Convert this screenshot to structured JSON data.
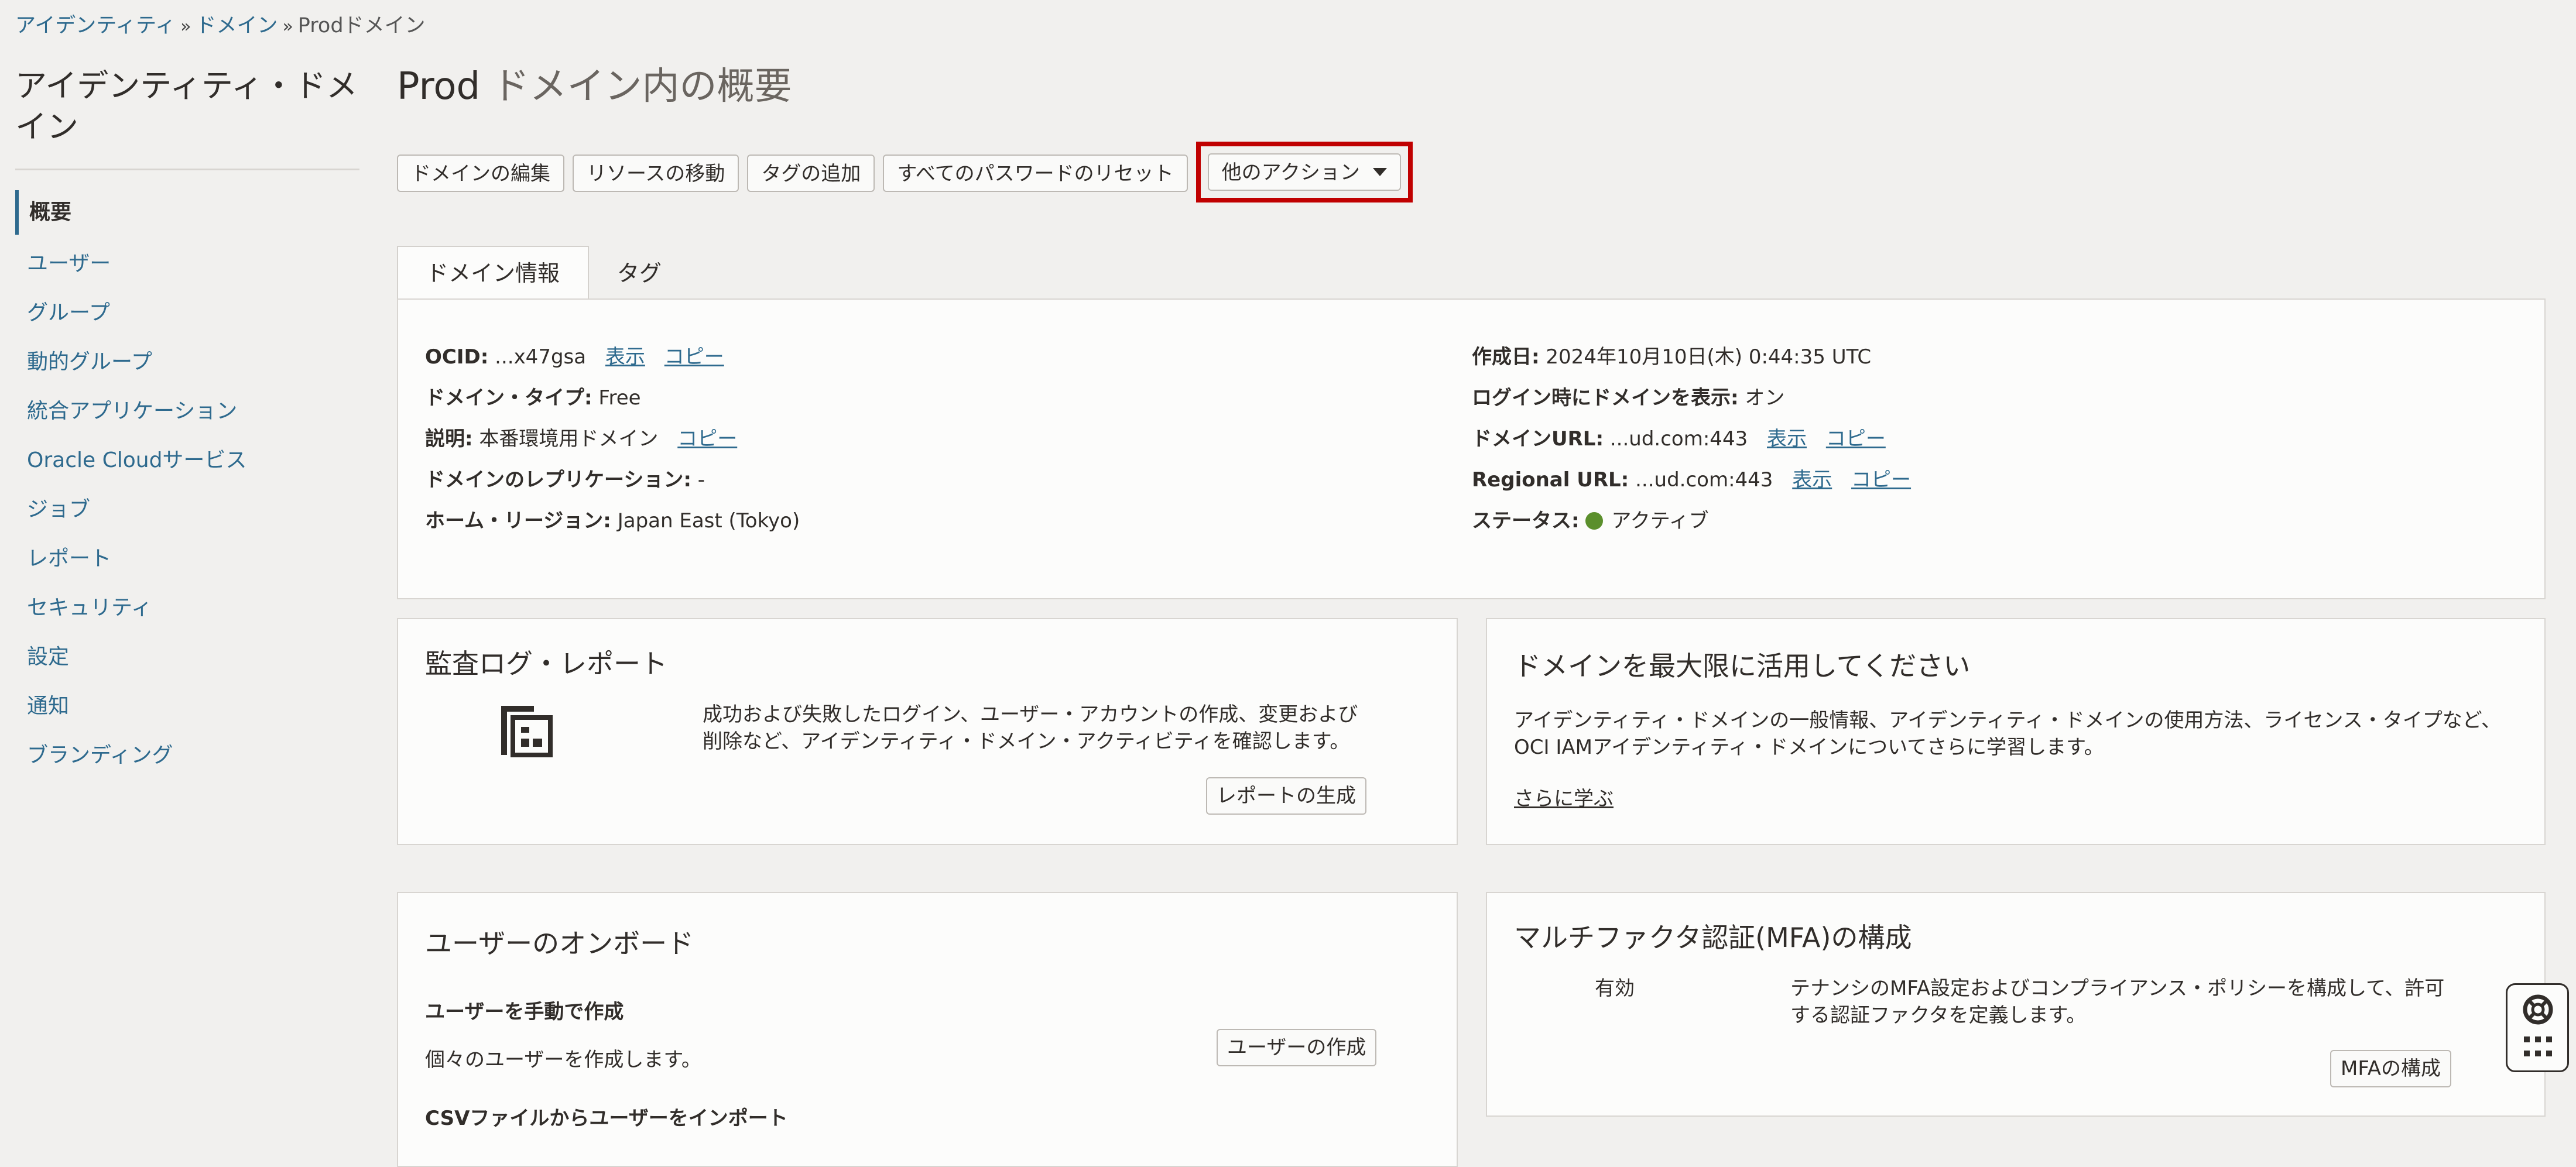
{
  "breadcrumb": {
    "items": [
      "アイデンティティ",
      "ドメイン"
    ],
    "separator": "»",
    "current": "Prodドメイン"
  },
  "sidebar": {
    "title": "アイデンティティ・ドメイン",
    "items": [
      {
        "label": "概要",
        "active": true
      },
      {
        "label": "ユーザー"
      },
      {
        "label": "グループ"
      },
      {
        "label": "動的グループ"
      },
      {
        "label": "統合アプリケーション"
      },
      {
        "label": "Oracle Cloudサービス"
      },
      {
        "label": "ジョブ"
      },
      {
        "label": "レポート"
      },
      {
        "label": "セキュリティ"
      },
      {
        "label": "設定"
      },
      {
        "label": "通知"
      },
      {
        "label": "ブランディング"
      }
    ]
  },
  "page": {
    "title_part1": "Prod",
    "title_part2": "ドメイン内の概要"
  },
  "toolbar": {
    "edit_domain": "ドメインの編集",
    "move_resource": "リソースの移動",
    "add_tags": "タグの追加",
    "reset_passwords": "すべてのパスワードのリセット",
    "more_actions": "他のアクション"
  },
  "tabs": {
    "domain_info": "ドメイン情報",
    "tags": "タグ"
  },
  "domain_info": {
    "ocid_label": "OCID:",
    "ocid_value": "...x47gsa",
    "domain_type_label": "ドメイン・タイプ:",
    "domain_type_value": "Free",
    "description_label": "説明:",
    "description_value": "本番環境用ドメイン",
    "replication_label": "ドメインのレプリケーション:",
    "replication_value": "-",
    "home_region_label": "ホーム・リージョン:",
    "home_region_value": "Japan East (Tokyo)",
    "created_label": "作成日:",
    "created_value": "2024年10月10日(木) 0:44:35 UTC",
    "show_on_login_label": "ログイン時にドメインを表示:",
    "show_on_login_value": "オン",
    "domain_url_label": "ドメインURL:",
    "domain_url_value": "...ud.com:443",
    "regional_url_label": "Regional URL:",
    "regional_url_value": "...ud.com:443",
    "status_label": "ステータス:",
    "status_value": "アクティブ",
    "status_color": "#5b8f2c",
    "show_link": "表示",
    "copy_link": "コピー"
  },
  "audit_card": {
    "title": "監査ログ・レポート",
    "icon": "report-icon",
    "text": "成功および失敗したログイン、ユーザー・アカウントの作成、変更および削除など、アイデンティティ・ドメイン・アクティビティを確認します。",
    "button": "レポートの生成"
  },
  "learn_card": {
    "title": "ドメインを最大限に活用してください",
    "text": "アイデンティティ・ドメインの一般情報、アイデンティティ・ドメインの使用方法、ライセンス・タイプなど、OCI IAMアイデンティティ・ドメインについてさらに学習します。",
    "link": "さらに学ぶ"
  },
  "onboard_card": {
    "title": "ユーザーのオンボード",
    "manual_heading": "ユーザーを手動で作成",
    "manual_text": "個々のユーザーを作成します。",
    "create_button": "ユーザーの作成",
    "csv_heading": "CSVファイルからユーザーをインポート"
  },
  "mfa_card": {
    "title": "マルチファクタ認証(MFA)の構成",
    "status": "有効",
    "text": "テナンシのMFA設定およびコンプライアンス・ポリシーを構成して、許可する認証ファクタを定義します。",
    "button": "MFAの構成"
  },
  "colors": {
    "link": "#2e6a8e",
    "highlight": "#c00000",
    "background": "#f1f0ee"
  }
}
